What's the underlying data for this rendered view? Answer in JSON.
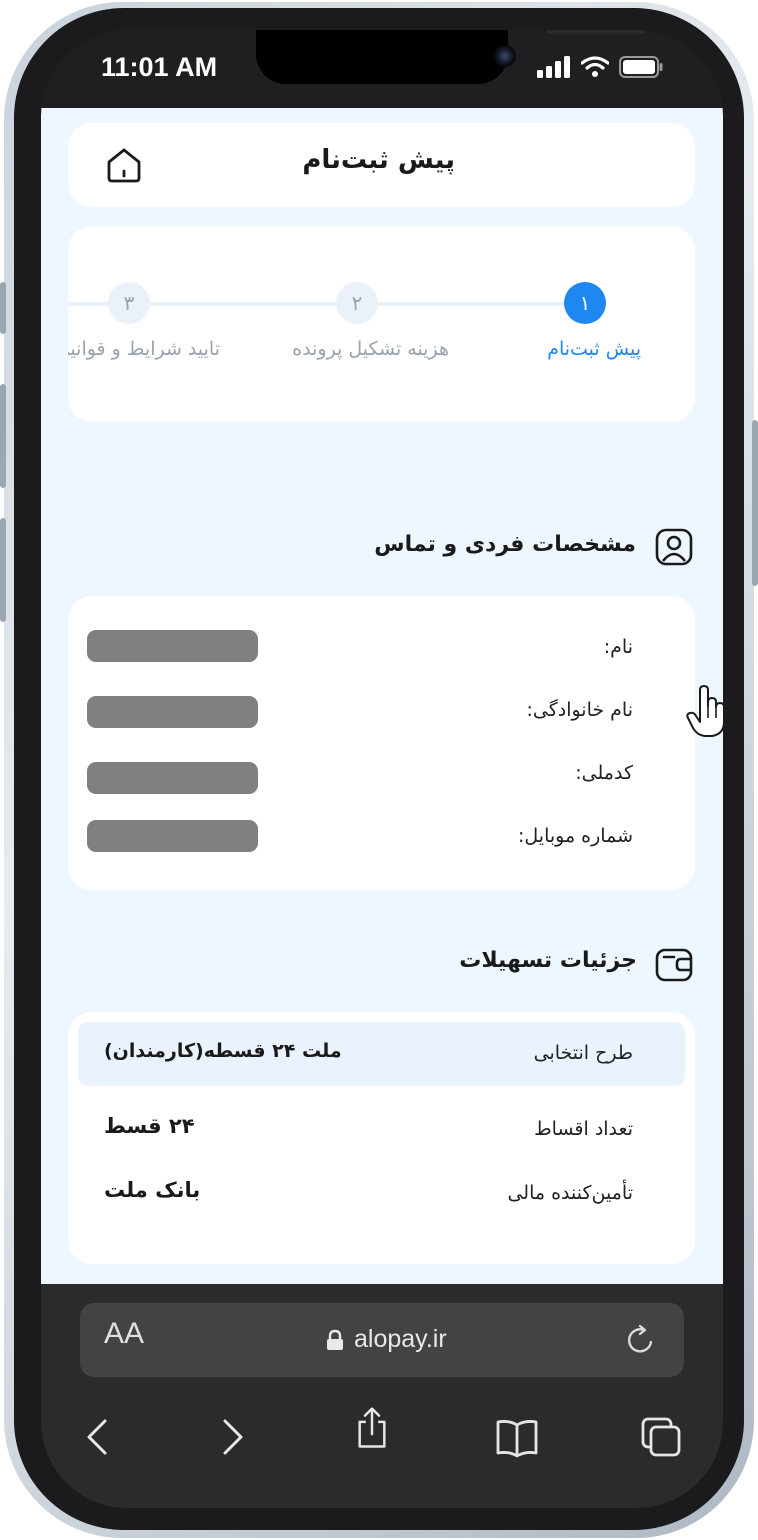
{
  "status_bar": {
    "time": "11:01 AM"
  },
  "header": {
    "title": "پیش ثبت‌نام"
  },
  "stepper": {
    "steps": [
      {
        "number": "۱",
        "label": "پیش ثبت‌نام",
        "active": true
      },
      {
        "number": "۲",
        "label": "هزینه تشکیل پرونده",
        "active": false
      },
      {
        "number": "۳",
        "label": "تایید شرایط و قوانین",
        "active": false
      }
    ]
  },
  "personal": {
    "title": "مشخصات فردی و تماس",
    "fields": [
      {
        "label": "نام:"
      },
      {
        "label": "نام خانوادگی:"
      },
      {
        "label": "کدملی:"
      },
      {
        "label": "شماره موبایل:"
      }
    ]
  },
  "facility": {
    "title": "جزئیات تسهیلات",
    "rows": [
      {
        "label": "طرح انتخابی",
        "value": "ملت ۲۴ قسطه(کارمندان)"
      },
      {
        "label": "تعداد اقساط",
        "value": "۲۴ قسط"
      },
      {
        "label": "تأمین‌کننده مالی",
        "value": "بانک ملت"
      }
    ]
  },
  "browser": {
    "text_size_label": "AA",
    "url": "alopay.ir"
  },
  "colors": {
    "accent": "#1e88f0",
    "page_bg": "#eef6ff",
    "inactive": "#9aa3ad"
  }
}
